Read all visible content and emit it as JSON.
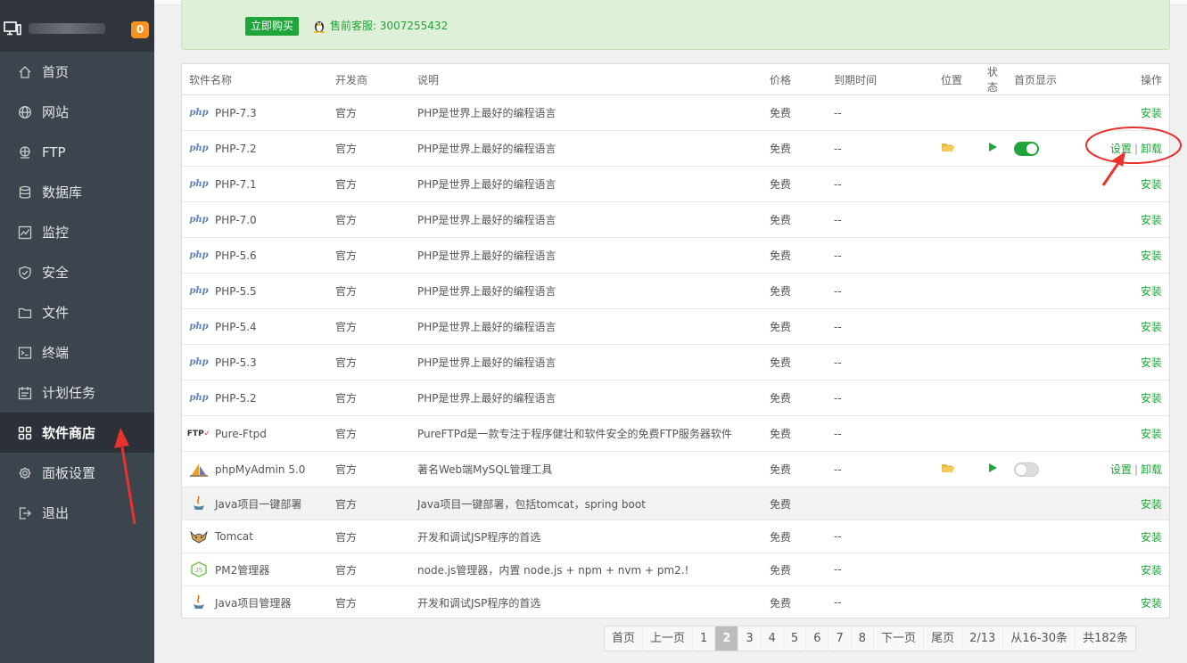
{
  "sidebar": {
    "badge": "0",
    "items": [
      {
        "label": "首页",
        "icon": "home-icon"
      },
      {
        "label": "网站",
        "icon": "globe-icon"
      },
      {
        "label": "FTP",
        "icon": "ftp-icon"
      },
      {
        "label": "数据库",
        "icon": "database-icon"
      },
      {
        "label": "监控",
        "icon": "monitor-chart-icon"
      },
      {
        "label": "安全",
        "icon": "shield-icon"
      },
      {
        "label": "文件",
        "icon": "folder-icon"
      },
      {
        "label": "终端",
        "icon": "terminal-icon"
      },
      {
        "label": "计划任务",
        "icon": "calendar-icon"
      },
      {
        "label": "软件商店",
        "icon": "grid-icon",
        "active": true
      },
      {
        "label": "面板设置",
        "icon": "gear-icon"
      },
      {
        "label": "退出",
        "icon": "logout-icon"
      }
    ]
  },
  "notice": {
    "buy_label": "立即购买",
    "support_text": "售前客服: 3007255432"
  },
  "table": {
    "headers": {
      "name": "软件名称",
      "dev": "开发商",
      "desc": "说明",
      "price": "价格",
      "expire": "到期时间",
      "location": "位置",
      "status": "状态",
      "home": "首页显示",
      "op": "操作"
    },
    "rows": [
      {
        "name": "PHP-7.3",
        "logo": "php",
        "dev": "官方",
        "desc": "PHP是世界上最好的编程语言",
        "price": "免费",
        "expire": "--",
        "ops": [
          "安装"
        ]
      },
      {
        "name": "PHP-7.2",
        "logo": "php",
        "dev": "官方",
        "desc": "PHP是世界上最好的编程语言",
        "price": "免费",
        "expire": "--",
        "installed": true,
        "home_on": true,
        "ops": [
          "设置",
          "卸载"
        ]
      },
      {
        "name": "PHP-7.1",
        "logo": "php",
        "dev": "官方",
        "desc": "PHP是世界上最好的编程语言",
        "price": "免费",
        "expire": "--",
        "ops": [
          "安装"
        ]
      },
      {
        "name": "PHP-7.0",
        "logo": "php",
        "dev": "官方",
        "desc": "PHP是世界上最好的编程语言",
        "price": "免费",
        "expire": "--",
        "ops": [
          "安装"
        ]
      },
      {
        "name": "PHP-5.6",
        "logo": "php",
        "dev": "官方",
        "desc": "PHP是世界上最好的编程语言",
        "price": "免费",
        "expire": "--",
        "ops": [
          "安装"
        ]
      },
      {
        "name": "PHP-5.5",
        "logo": "php",
        "dev": "官方",
        "desc": "PHP是世界上最好的编程语言",
        "price": "免费",
        "expire": "--",
        "ops": [
          "安装"
        ]
      },
      {
        "name": "PHP-5.4",
        "logo": "php",
        "dev": "官方",
        "desc": "PHP是世界上最好的编程语言",
        "price": "免费",
        "expire": "--",
        "ops": [
          "安装"
        ]
      },
      {
        "name": "PHP-5.3",
        "logo": "php",
        "dev": "官方",
        "desc": "PHP是世界上最好的编程语言",
        "price": "免费",
        "expire": "--",
        "ops": [
          "安装"
        ]
      },
      {
        "name": "PHP-5.2",
        "logo": "php",
        "dev": "官方",
        "desc": "PHP是世界上最好的编程语言",
        "price": "免费",
        "expire": "--",
        "ops": [
          "安装"
        ]
      },
      {
        "name": "Pure-Ftpd",
        "logo": "ftp",
        "dev": "官方",
        "desc": "PureFTPd是一款专注于程序健壮和软件安全的免费FTP服务器软件",
        "price": "免费",
        "expire": "--",
        "ops": [
          "安装"
        ]
      },
      {
        "name": "phpMyAdmin 5.0",
        "logo": "pma",
        "dev": "官方",
        "desc": "著名Web端MySQL管理工具",
        "price": "免费",
        "expire": "--",
        "installed": true,
        "home_on": false,
        "ops": [
          "设置",
          "卸载"
        ]
      },
      {
        "name": "Java项目一键部署",
        "logo": "java",
        "dev": "官方",
        "desc": "Java项目一键部署，包括tomcat，spring boot",
        "price": "免费",
        "expire": "",
        "ops": [
          "安装"
        ],
        "highlight": true
      },
      {
        "name": "Tomcat",
        "logo": "tomcat",
        "dev": "官方",
        "desc": "开发和调试JSP程序的首选",
        "price": "免费",
        "expire": "--",
        "ops": [
          "安装"
        ]
      },
      {
        "name": "PM2管理器",
        "logo": "node",
        "dev": "官方",
        "desc": "node.js管理器，内置 node.js + npm + nvm + pm2.!",
        "price": "免费",
        "expire": "--",
        "ops": [
          "安装"
        ]
      },
      {
        "name": "Java项目管理器",
        "logo": "java",
        "dev": "官方",
        "desc": "开发和调试JSP程序的首选",
        "price": "免费",
        "expire": "--",
        "ops": [
          "安装"
        ]
      }
    ]
  },
  "pager": {
    "items": [
      "首页",
      "上一页",
      "1",
      "2",
      "3",
      "4",
      "5",
      "6",
      "7",
      "8",
      "下一页",
      "尾页",
      "2/13",
      "从16-30条",
      "共182条"
    ],
    "current": "2"
  },
  "colors": {
    "accent": "#20a53a",
    "sidebar": "#3c444d",
    "annotation": "#e8322d"
  }
}
